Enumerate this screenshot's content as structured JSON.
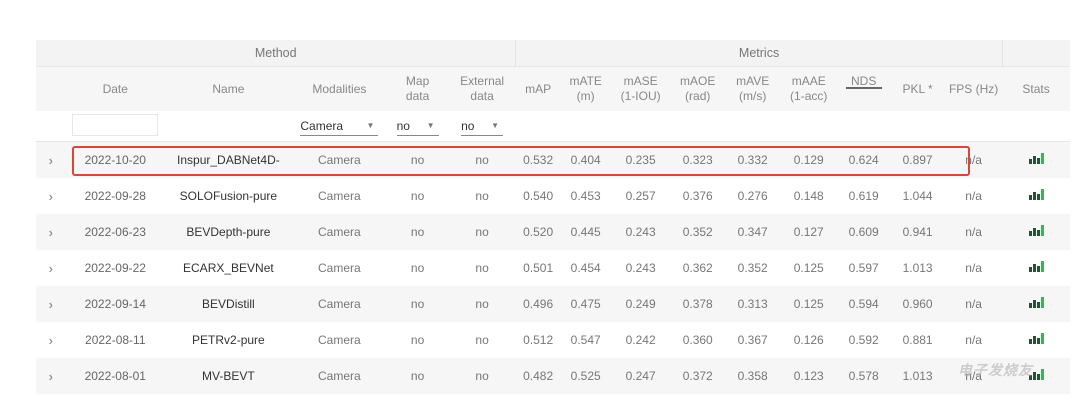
{
  "groups": {
    "method": "Method",
    "metrics": "Metrics"
  },
  "columns": {
    "date": "Date",
    "name": "Name",
    "modalities": "Modalities",
    "map": [
      "Map",
      "data"
    ],
    "external": [
      "External",
      "data"
    ],
    "map_full": "mAP",
    "mate": [
      "mATE",
      "(m)"
    ],
    "mase": [
      "mASE",
      "(1-IOU)"
    ],
    "maoe": [
      "mAOE",
      "(rad)"
    ],
    "mave": [
      "mAVE",
      "(m/s)"
    ],
    "maae": [
      "mAAE",
      "(1-acc)"
    ],
    "nds": "NDS",
    "pkl": "PKL *",
    "fps": "FPS (Hz)",
    "stats": "Stats"
  },
  "filters": {
    "modalities": "Camera",
    "map": "no",
    "external": "no"
  },
  "rows": [
    {
      "date": "2022-10-20",
      "name": "Inspur_DABNet4D-",
      "modalities": "Camera",
      "map": "no",
      "external": "no",
      "mAP": "0.532",
      "mATE": "0.404",
      "mASE": "0.235",
      "mAOE": "0.323",
      "mAVE": "0.332",
      "mAAE": "0.129",
      "NDS": "0.624",
      "PKL": "0.897",
      "FPS": "n/a"
    },
    {
      "date": "2022-09-28",
      "name": "SOLOFusion-pure",
      "modalities": "Camera",
      "map": "no",
      "external": "no",
      "mAP": "0.540",
      "mATE": "0.453",
      "mASE": "0.257",
      "mAOE": "0.376",
      "mAVE": "0.276",
      "mAAE": "0.148",
      "NDS": "0.619",
      "PKL": "1.044",
      "FPS": "n/a"
    },
    {
      "date": "2022-06-23",
      "name": "BEVDepth-pure",
      "modalities": "Camera",
      "map": "no",
      "external": "no",
      "mAP": "0.520",
      "mATE": "0.445",
      "mASE": "0.243",
      "mAOE": "0.352",
      "mAVE": "0.347",
      "mAAE": "0.127",
      "NDS": "0.609",
      "PKL": "0.941",
      "FPS": "n/a"
    },
    {
      "date": "2022-09-22",
      "name": "ECARX_BEVNet",
      "modalities": "Camera",
      "map": "no",
      "external": "no",
      "mAP": "0.501",
      "mATE": "0.454",
      "mASE": "0.243",
      "mAOE": "0.362",
      "mAVE": "0.352",
      "mAAE": "0.125",
      "NDS": "0.597",
      "PKL": "1.013",
      "FPS": "n/a"
    },
    {
      "date": "2022-09-14",
      "name": "BEVDistill",
      "modalities": "Camera",
      "map": "no",
      "external": "no",
      "mAP": "0.496",
      "mATE": "0.475",
      "mASE": "0.249",
      "mAOE": "0.378",
      "mAVE": "0.313",
      "mAAE": "0.125",
      "NDS": "0.594",
      "PKL": "0.960",
      "FPS": "n/a"
    },
    {
      "date": "2022-08-11",
      "name": "PETRv2-pure",
      "modalities": "Camera",
      "map": "no",
      "external": "no",
      "mAP": "0.512",
      "mATE": "0.547",
      "mASE": "0.242",
      "mAOE": "0.360",
      "mAVE": "0.367",
      "mAAE": "0.126",
      "NDS": "0.592",
      "PKL": "0.881",
      "FPS": "n/a"
    },
    {
      "date": "2022-08-01",
      "name": "MV-BEVT",
      "modalities": "Camera",
      "map": "no",
      "external": "no",
      "mAP": "0.482",
      "mATE": "0.525",
      "mASE": "0.247",
      "mAOE": "0.372",
      "mAVE": "0.358",
      "mAAE": "0.123",
      "NDS": "0.578",
      "PKL": "1.013",
      "FPS": "n/a"
    }
  ],
  "icons": {
    "expand": "chevron-right-icon",
    "stats": "bar-chart-icon"
  },
  "colors": {
    "highlight": "#d8453a",
    "stats_accent": "#3fb05a",
    "stats_dark": "#2b4d3a"
  },
  "watermark": "电子发烧友"
}
